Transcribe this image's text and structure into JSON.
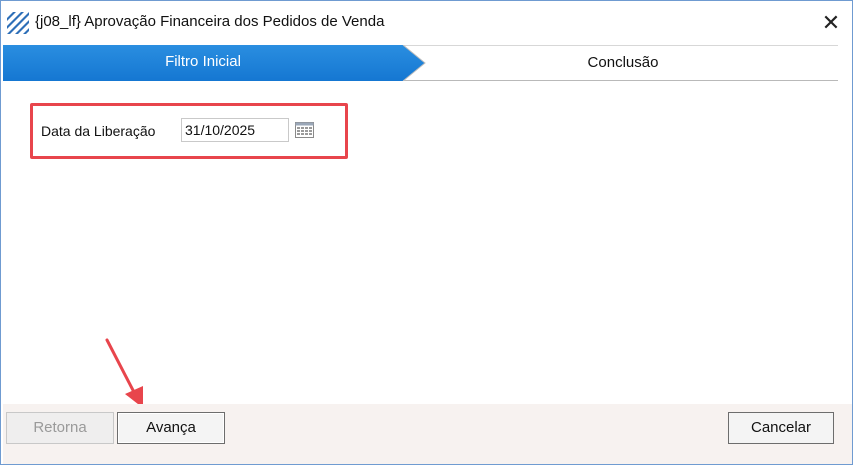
{
  "window": {
    "title": "{j08_lf}  Aprovação Financeira dos Pedidos de Venda",
    "close_glyph": "✕",
    "icon": "app-logo-icon"
  },
  "steps": [
    {
      "label": "Filtro Inicial",
      "active": true
    },
    {
      "label": "Conclusão",
      "active": false
    }
  ],
  "form": {
    "release_date_label": "Data da Liberação",
    "release_date_value": "31/10/2025",
    "calendar_icon": "calendar-icon"
  },
  "footer": {
    "back_label": "Retorna",
    "next_label": "Avança",
    "cancel_label": "Cancelar"
  },
  "colors": {
    "accent": "#1a7fd8",
    "highlight": "#e8454c",
    "annotation_arrow": "#e8454c"
  }
}
